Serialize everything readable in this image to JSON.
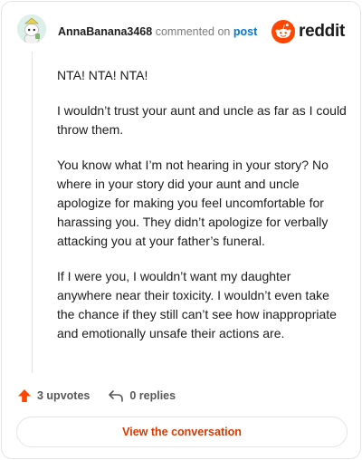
{
  "comment": {
    "author": "AnnaBanana3468",
    "action_text": "commented on",
    "post_link": "post",
    "paragraphs": [
      "NTA! NTA! NTA!",
      "I wouldn’t trust your aunt and uncle as far as I could throw them.",
      "You know what I’m not hearing in your story? No where in your story did your aunt and uncle apologize for making you feel uncomfortable for harassing you. They didn’t apologize for verbally attacking you at your father’s funeral.",
      "If I were you, I wouldn’t want my daughter anywhere near their toxicity. I wouldn’t even take the chance if they still can’t see how inappropriate and emotionally unsafe their actions are."
    ]
  },
  "brand": {
    "wordmark": "reddit",
    "color": "#ff4500"
  },
  "footer": {
    "upvotes": "3 upvotes",
    "replies": "0 replies",
    "upvote_icon": "arrow-up-icon",
    "reply_icon": "reply-arrow-icon"
  },
  "actions": {
    "view_conversation": "View the conversation"
  }
}
